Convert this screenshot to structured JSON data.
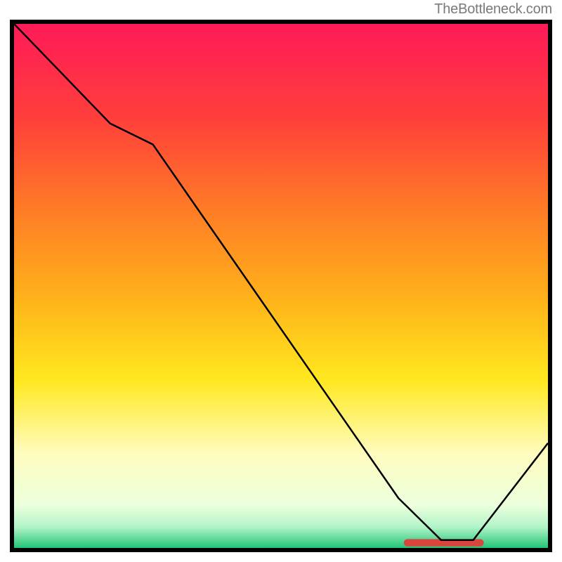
{
  "attribution": "TheBottleneck.com",
  "chart_data": {
    "type": "line",
    "title": "",
    "xlabel": "",
    "ylabel": "",
    "xlim": [
      0,
      100
    ],
    "ylim": [
      0,
      100
    ],
    "x": [
      0,
      18,
      26,
      72,
      80,
      86,
      100
    ],
    "values": [
      100,
      81,
      77,
      9.5,
      1.5,
      1.5,
      20
    ],
    "trough_marker": {
      "x_start": 73,
      "x_end": 88,
      "y": 0.5,
      "color": "#d9453c"
    },
    "gradient_stops": [
      {
        "pct": 0,
        "color": "#ff1a58"
      },
      {
        "pct": 18,
        "color": "#ff3f3b"
      },
      {
        "pct": 35,
        "color": "#ff7a26"
      },
      {
        "pct": 53,
        "color": "#ffb41a"
      },
      {
        "pct": 68,
        "color": "#ffe81f"
      },
      {
        "pct": 82,
        "color": "#fffcbf"
      },
      {
        "pct": 92,
        "color": "#eaffdc"
      },
      {
        "pct": 96,
        "color": "#b1f4c8"
      },
      {
        "pct": 100,
        "color": "#22c477"
      }
    ],
    "line_color": "#000000",
    "line_width": 2.5
  }
}
